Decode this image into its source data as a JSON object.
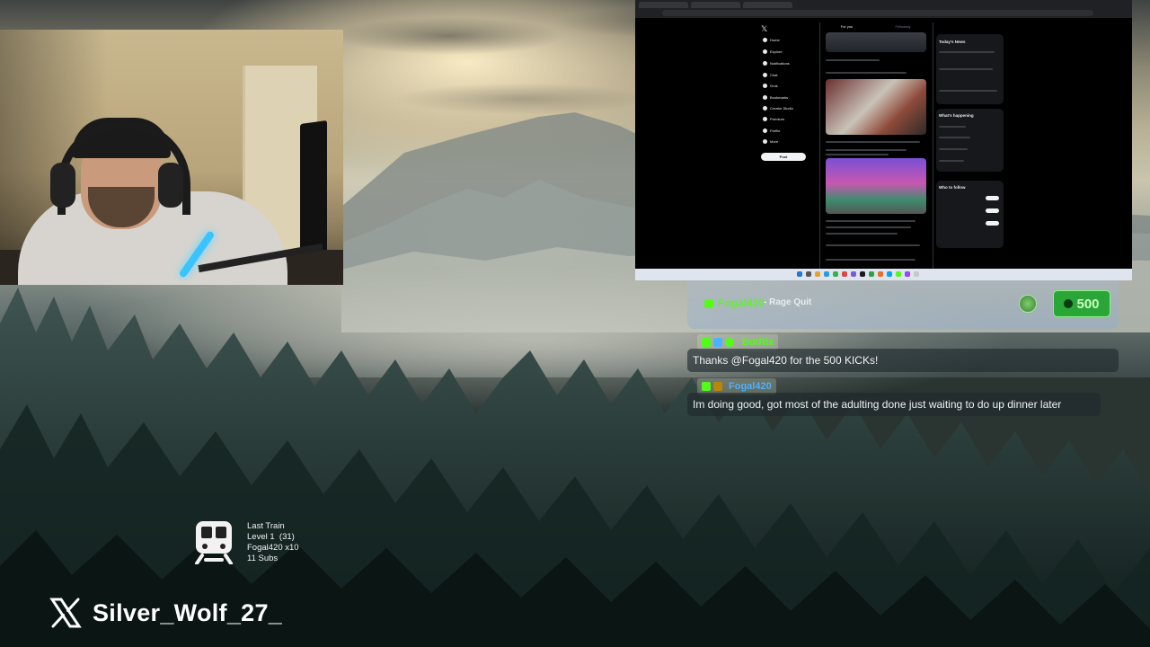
{
  "screen_share": {
    "x_nav": [
      "Home",
      "Explore",
      "Notifications",
      "Chat",
      "Grok",
      "Bookmarks",
      "Creator Studio",
      "Premium",
      "Profile",
      "More"
    ],
    "post_button": "Post",
    "feed_tabs": [
      "For you",
      "Following"
    ],
    "right_titles": [
      "Today's News",
      "What's happening",
      "Who to follow"
    ]
  },
  "kick_alert": {
    "username": "Fogal420",
    "label": "- Rage Quit",
    "amount": "500",
    "accent_color": "#53fc18"
  },
  "chat": {
    "messages": [
      {
        "user": "BotRix",
        "user_color": "#53fc18",
        "text": "Thanks @Fogal420 for the 500 KICKs!"
      },
      {
        "user": "Fogal420",
        "user_color": "#4db1ff",
        "text": "Im doing good, got most of the adulting done just waiting to do up dinner later"
      }
    ]
  },
  "last_train": {
    "title": "Last Train",
    "level": "Level 1  (31)",
    "top": "Fogal420 x10",
    "subs": "11 Subs",
    "icon": "train-icon"
  },
  "handle": {
    "icon": "x-logo-icon",
    "name": "Silver_Wolf_27_"
  }
}
